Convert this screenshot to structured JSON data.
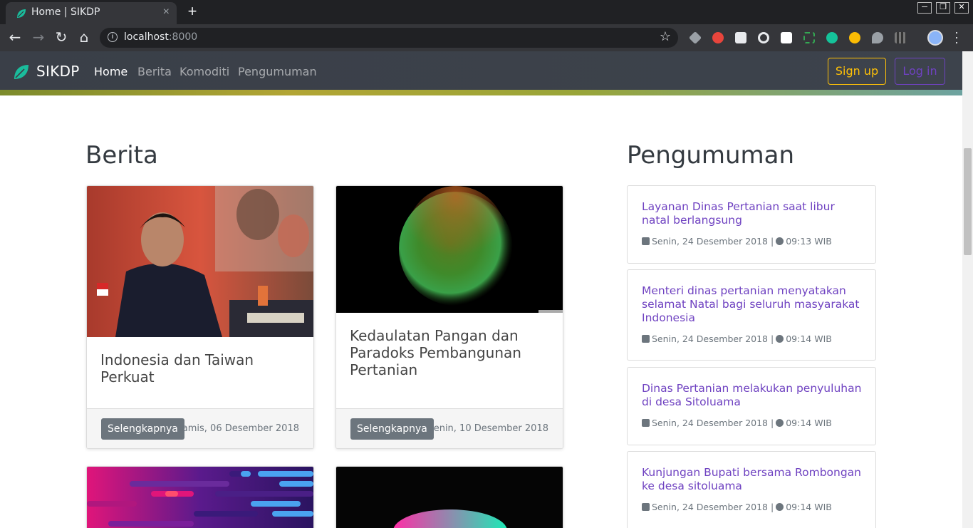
{
  "browser": {
    "tab_title": "Home | SIKDP",
    "tab_close": "×",
    "new_tab": "+",
    "url_host": "localhost",
    "url_port": ":8000",
    "win_min": "─",
    "win_max": "❐",
    "win_close": "✕"
  },
  "navbar": {
    "brand": "SIKDP",
    "links": [
      "Home",
      "Berita",
      "Komoditi",
      "Pengumuman"
    ],
    "signup": "Sign up",
    "login": "Log in"
  },
  "berita": {
    "heading": "Berita",
    "cards": [
      {
        "title": "Indonesia dan Taiwan Perkuat",
        "button": "Selengkapnya",
        "date": "Kamis, 06 Desember 2018"
      },
      {
        "title": "Kedaulatan Pangan dan Paradoks Pembangunan Pertanian",
        "button": "Selengkapnya",
        "date": "Senin, 10 Desember 2018"
      }
    ]
  },
  "pengumuman": {
    "heading": "Pengumuman",
    "items": [
      {
        "title": "Layanan Dinas Pertanian saat libur natal berlangsung",
        "date": "Senin, 24 Desember 2018",
        "sep": "|",
        "time": "09:13 WIB"
      },
      {
        "title": "Menteri dinas pertanian menyatakan selamat Natal bagi seluruh masyarakat Indonesia",
        "date": "Senin, 24 Desember 2018",
        "sep": "|",
        "time": "09:14 WIB"
      },
      {
        "title": "Dinas Pertanian melakukan penyuluhan di desa Sitoluama",
        "date": "Senin, 24 Desember 2018",
        "sep": "|",
        "time": "09:14 WIB"
      },
      {
        "title": "Kunjungan Bupati bersama Rombongan ke desa sitoluama",
        "date": "Senin, 24 Desember 2018",
        "sep": "|",
        "time": "09:14 WIB"
      }
    ]
  },
  "colors": {
    "brand_leaf": "#1abc9c",
    "signup": "#ffc107",
    "login": "#6f42c1",
    "link": "#6f42c1"
  }
}
